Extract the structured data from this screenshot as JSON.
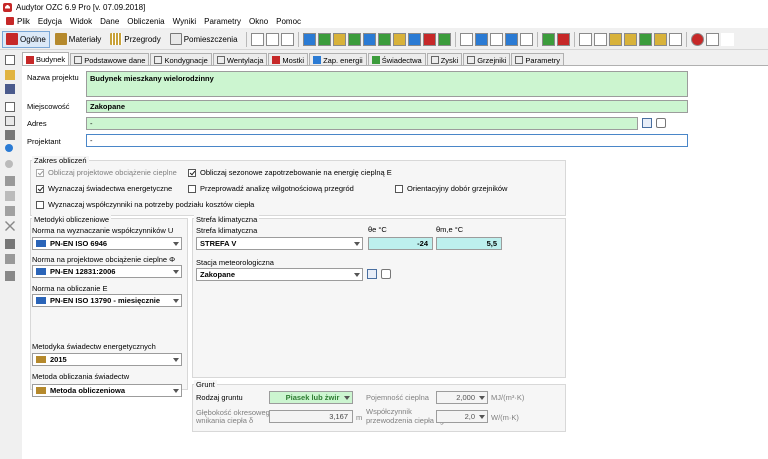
{
  "window": {
    "title": "Audytor OZC 6.9 Pro [v. 07.09.2018]"
  },
  "menu": [
    "Plik",
    "Edycja",
    "Widok",
    "Dane",
    "Obliczenia",
    "Wyniki",
    "Parametry",
    "Okno",
    "Pomoc"
  ],
  "toolbar": {
    "buttons": [
      "Ogólne",
      "Materiały",
      "Przegrody",
      "Pomieszczenia"
    ],
    "active": "Ogólne"
  },
  "tabs": [
    "Budynek",
    "Podstawowe dane",
    "Kondygnacje",
    "Wentylacja",
    "Mostki",
    "Zap. energii",
    "Świadectwa",
    "Zyski",
    "Grzejniki",
    "Parametry"
  ],
  "project": {
    "name_label": "Nazwa projektu",
    "name_value": "Budynek mieszkany wielorodzinny",
    "city_label": "Miejscowość",
    "city_value": "Zakopane",
    "address_label": "Adres",
    "address_value": "-",
    "designer_label": "Projektant",
    "designer_value": "-"
  },
  "scope": {
    "title": "Zakres obliczeń",
    "opt1": "Obliczaj projektowe obciążenie cieplne",
    "opt2": "Obliczaj sezonowe zapotrzebowanie na energię cieplną E",
    "opt3": "Wyznaczaj świadectwa energetyczne",
    "opt4": "Przeprowadź analizę wilgotnościową przegród",
    "opt5": "Orientacyjny dobór grzejników",
    "opt6": "Wyznaczaj współczynniki na potrzeby podziału kosztów ciepła"
  },
  "methods": {
    "title": "Metodyki obliczeniowe",
    "u_label": "Norma na wyznaczanie współczynników U",
    "u_value": "PN-EN ISO 6946",
    "load_label": "Norma na projektowe obciążenie cieplne Φ",
    "load_value": "PN-EN 12831:2006",
    "e_label": "Norma na obliczanie E",
    "e_value": "PN-EN ISO 13790 - miesięcznie",
    "cert_method_label": "Metodyka świadectw energetycznych",
    "cert_method_value": "2015",
    "calc_method_label": "Metoda obliczania świadectw",
    "calc_method_value": "Metoda obliczeniowa"
  },
  "climate": {
    "title": "Strefa klimatyczna",
    "zone_label": "Strefa klimatyczna",
    "zone_value": "STREFA V",
    "te_label": "θe  °C",
    "te_value": "-24",
    "tme_label": "θm,e  °C",
    "tme_value": "5,5",
    "station_label": "Stacja meteorologiczna",
    "station_value": "Zakopane"
  },
  "ground": {
    "title": "Grunt",
    "type_label": "Rodzaj gruntu",
    "type_value": "Piasek lub żwir",
    "capacity_label": "Pojemność cieplna",
    "capacity_value": "2,000",
    "capacity_unit": "MJ/(m³·K)",
    "depth_label_1": "Głębokość okresowego",
    "depth_label_2": "wnikania ciepła δ",
    "depth_value": "3,167",
    "depth_unit": "m",
    "cond_label_1": "Współczynnik",
    "cond_label_2": "przewodzenia ciepła λg",
    "cond_value": "2,0",
    "cond_unit": "W/(m·K)"
  }
}
